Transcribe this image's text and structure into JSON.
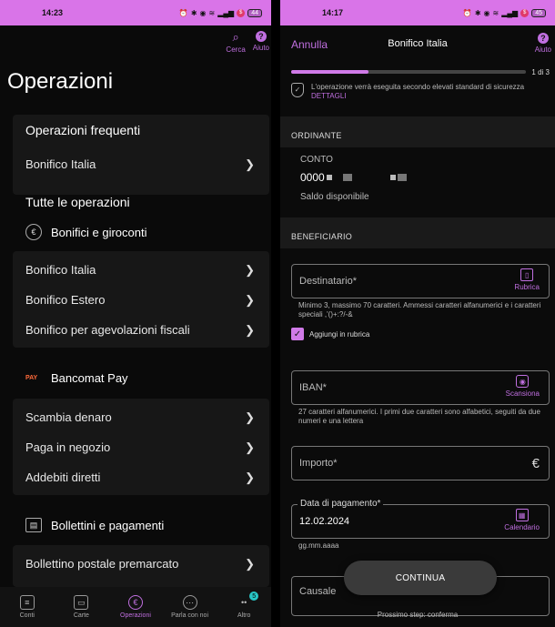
{
  "left": {
    "status": {
      "time": "14:23",
      "battery": "44"
    },
    "actions": [
      {
        "label": "Cerca",
        "icon": "search-icon"
      },
      {
        "label": "Aiuto",
        "icon": "help-icon"
      }
    ],
    "title": "Operazioni",
    "frequent": {
      "heading": "Operazioni frequenti",
      "items": [
        "Bonifico Italia"
      ]
    },
    "all_heading": "Tutte le operazioni",
    "groups": [
      {
        "title": "Bonifici e giroconti",
        "icon": "money-bag-icon",
        "items": [
          "Bonifico Italia",
          "Bonifico Estero",
          "Bonifico per agevolazioni fiscali"
        ]
      },
      {
        "title": "Bancomat Pay",
        "icon": "bancomat-pay-logo",
        "logo_text": "PAY",
        "items": [
          "Scambia denaro",
          "Paga in negozio",
          "Addebiti diretti"
        ]
      },
      {
        "title": "Bollettini e pagamenti",
        "icon": "bill-icon",
        "items": [
          "Bollettino postale premarcato"
        ]
      }
    ],
    "nav": [
      {
        "label": "Conti",
        "icon": "coins-icon",
        "active": false
      },
      {
        "label": "Carte",
        "icon": "card-icon",
        "active": false
      },
      {
        "label": "Operazioni",
        "icon": "euro-icon",
        "active": true
      },
      {
        "label": "Parla con noi",
        "icon": "chat-icon",
        "active": false
      },
      {
        "label": "Altro",
        "icon": "more-icon",
        "active": false,
        "badge": "5"
      }
    ]
  },
  "right": {
    "status": {
      "time": "14:17",
      "battery": "45"
    },
    "cancel": "Annulla",
    "title": "Bonifico Italia",
    "help": "Aiuto",
    "progress": 0.33,
    "step": "1 di 3",
    "security_note": "L'operazione verrà eseguita secondo elevati standard di sicurezza",
    "security_link": "DETTAGLI",
    "ordinante_heading": "ORDINANTE",
    "conto_label": "CONTO",
    "conto_prefix": "0000",
    "saldo_label": "Saldo disponibile",
    "beneficiario_heading": "BENEFICIARIO",
    "destinatario": {
      "label": "Destinatario*",
      "action": "Rubrica",
      "hint": "Minimo 3, massimo 70 caratteri. Ammessi caratteri alfanumerici e i caratteri speciali ,'()+:?/-&"
    },
    "rubrica_check": "Aggiungi in rubrica",
    "iban": {
      "label": "IBAN*",
      "action": "Scansiona",
      "hint": "27 caratteri alfanumerici. I primi due caratteri sono alfabetici, seguiti da due numeri e una lettera"
    },
    "importo": {
      "label": "Importo*",
      "symbol": "€"
    },
    "data": {
      "label": "Data di pagamento*",
      "value": "12.02.2024",
      "action": "Calendario",
      "hint": "gg.mm.aaaa"
    },
    "causale": {
      "label": "Causale"
    },
    "continue": "CONTINUA",
    "next_step": "Prossimo step: conferma"
  }
}
